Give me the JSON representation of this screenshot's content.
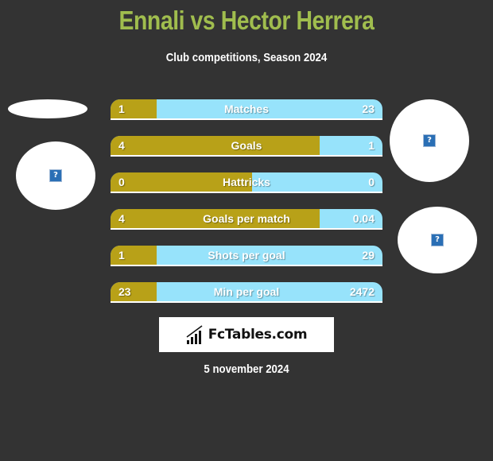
{
  "header": {
    "title": "Ennali vs Hector Herrera",
    "subtitle": "Club competitions, Season 2024"
  },
  "colors": {
    "background": "#333333",
    "title": "#a0bd4e",
    "left_bar": "#b8a118",
    "right_bar": "#97e3fb"
  },
  "players": {
    "left": {
      "name": "Ennali",
      "image": "missing-image-icon"
    },
    "right": {
      "name": "Hector Herrera",
      "images": [
        "missing-image-icon",
        "missing-image-icon"
      ]
    }
  },
  "stats": [
    {
      "label": "Matches",
      "left": "1",
      "right": "23",
      "left_share": 0.17
    },
    {
      "label": "Goals",
      "left": "4",
      "right": "1",
      "left_share": 0.77
    },
    {
      "label": "Hattricks",
      "left": "0",
      "right": "0",
      "left_share": 0.52
    },
    {
      "label": "Goals per match",
      "left": "4",
      "right": "0.04",
      "left_share": 0.77
    },
    {
      "label": "Shots per goal",
      "left": "1",
      "right": "29",
      "left_share": 0.17
    },
    {
      "label": "Min per goal",
      "left": "23",
      "right": "2472",
      "left_share": 0.17
    }
  ],
  "brand": {
    "name": "FcTables.com",
    "icon": "bar-chart-icon"
  },
  "footer": {
    "date": "5 november 2024"
  }
}
